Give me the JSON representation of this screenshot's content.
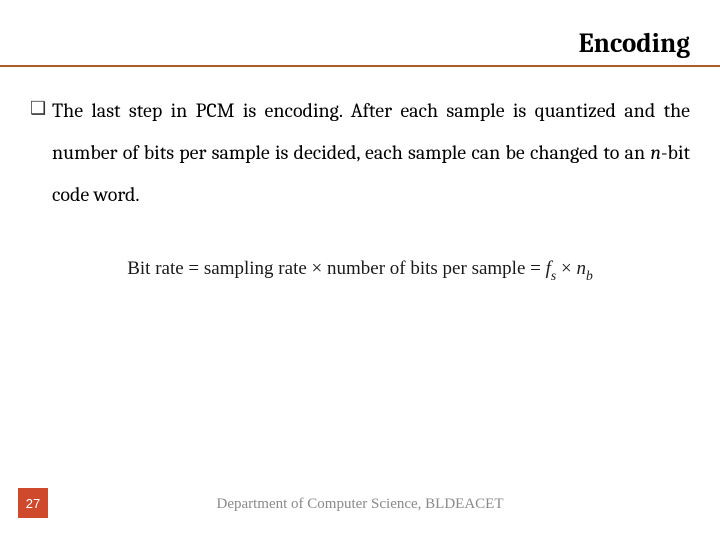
{
  "title": "Encoding",
  "bullet_glyph": "❑",
  "body": {
    "text_pre": "The last step in PCM is encoding. After each sample is quantized and the number of bits per sample is decided, each sample can be changed to an ",
    "italic": "n",
    "text_post": "-bit code word."
  },
  "formula": {
    "lhs": "Bit rate",
    "eq1": " = ",
    "mid": "sampling rate × number of bits per sample",
    "eq2": " = ",
    "f": "f",
    "f_sub": "s",
    "times": " × ",
    "n": "n",
    "n_sub": "b"
  },
  "page_number": "27",
  "footer": "Department of Computer Science, BLDEACET"
}
